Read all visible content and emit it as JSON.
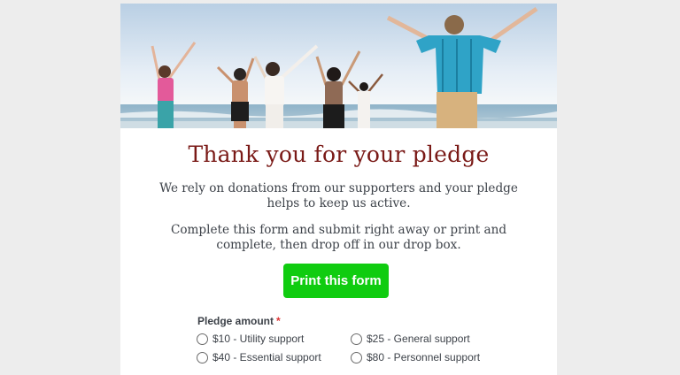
{
  "page": {
    "title": "Thank you for your pledge",
    "paragraph_1": "We rely on donations from our supporters and your pledge helps to keep us active.",
    "paragraph_2": "Complete this form and submit right away or print and complete, then drop off in our drop box.",
    "print_button_label": "Print this form"
  },
  "form": {
    "pledge_label": "Pledge amount",
    "required_marker": "*",
    "options": [
      {
        "label": "$10 - Utility support",
        "selected": false
      },
      {
        "label": "$25 - General support",
        "selected": false
      },
      {
        "label": "$40 - Essential support",
        "selected": false
      },
      {
        "label": "$80 - Personnel support",
        "selected": false
      }
    ]
  },
  "colors": {
    "page_background": "#ededed",
    "title": "#7a1a17",
    "print_button": "#10cc10",
    "required_marker": "#dd3333"
  }
}
